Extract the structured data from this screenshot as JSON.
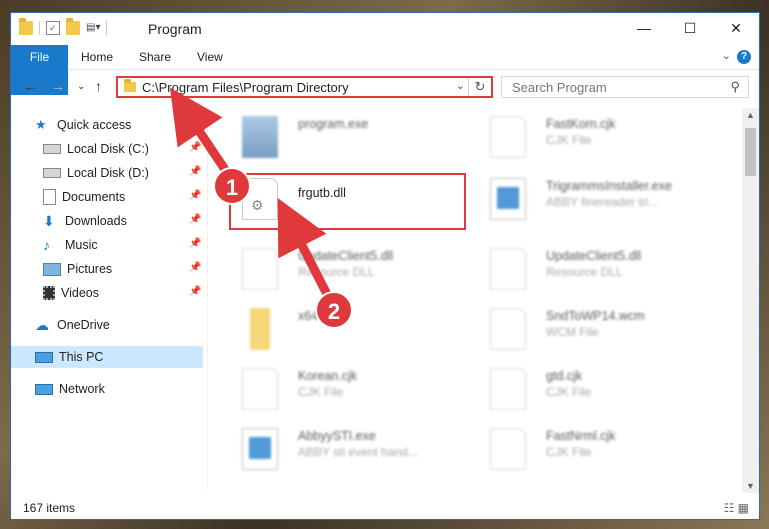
{
  "window": {
    "title": "Program"
  },
  "ribbon": {
    "tabs": [
      "File",
      "Home",
      "Share",
      "View"
    ],
    "help": "?"
  },
  "winbtns": {
    "minimize": "—",
    "maximize": "☐",
    "close": "✕"
  },
  "address": {
    "path": "C:\\Program Files\\Program Directory"
  },
  "search": {
    "placeholder": "Search Program"
  },
  "sidebar": {
    "items": [
      {
        "label": "Quick access",
        "icon": "star-icon"
      },
      {
        "label": "Local Disk (C:)",
        "icon": "drive-icon"
      },
      {
        "label": "Local Disk (D:)",
        "icon": "drive-icon"
      },
      {
        "label": "Documents",
        "icon": "documents-icon"
      },
      {
        "label": "Downloads",
        "icon": "downloads-icon"
      },
      {
        "label": "Music",
        "icon": "music-icon"
      },
      {
        "label": "Pictures",
        "icon": "pictures-icon"
      },
      {
        "label": "Videos",
        "icon": "videos-icon"
      },
      {
        "label": "OneDrive",
        "icon": "cloud-icon"
      },
      {
        "label": "This PC",
        "icon": "computer-icon"
      },
      {
        "label": "Network",
        "icon": "network-icon"
      }
    ]
  },
  "files": [
    {
      "name": "program.exe",
      "sub": ""
    },
    {
      "name": "FastKorn.cjk",
      "sub": "CJK File"
    },
    {
      "name": "frgutb.dll",
      "sub": ""
    },
    {
      "name": "TrigrammsInstaller.exe",
      "sub": "ABBY finereader tri..."
    },
    {
      "name": "UpdateClient5.dll",
      "sub": "Resource DLL"
    },
    {
      "name": "UpdateClient5.dll",
      "sub": "Resource DLL"
    },
    {
      "name": "x64",
      "sub": ""
    },
    {
      "name": "SndToWP14.wcm",
      "sub": "WCM File"
    },
    {
      "name": "Korean.cjk",
      "sub": "CJK File"
    },
    {
      "name": "gtd.cjk",
      "sub": "CJK File"
    },
    {
      "name": "AbbyySTI.exe",
      "sub": "ABBY sti event hand..."
    },
    {
      "name": "FastNrml.cjk",
      "sub": "CJK File"
    }
  ],
  "status": {
    "count": "167 items"
  },
  "annotations": {
    "step1": "1",
    "step2": "2",
    "color": "#e0393b"
  }
}
